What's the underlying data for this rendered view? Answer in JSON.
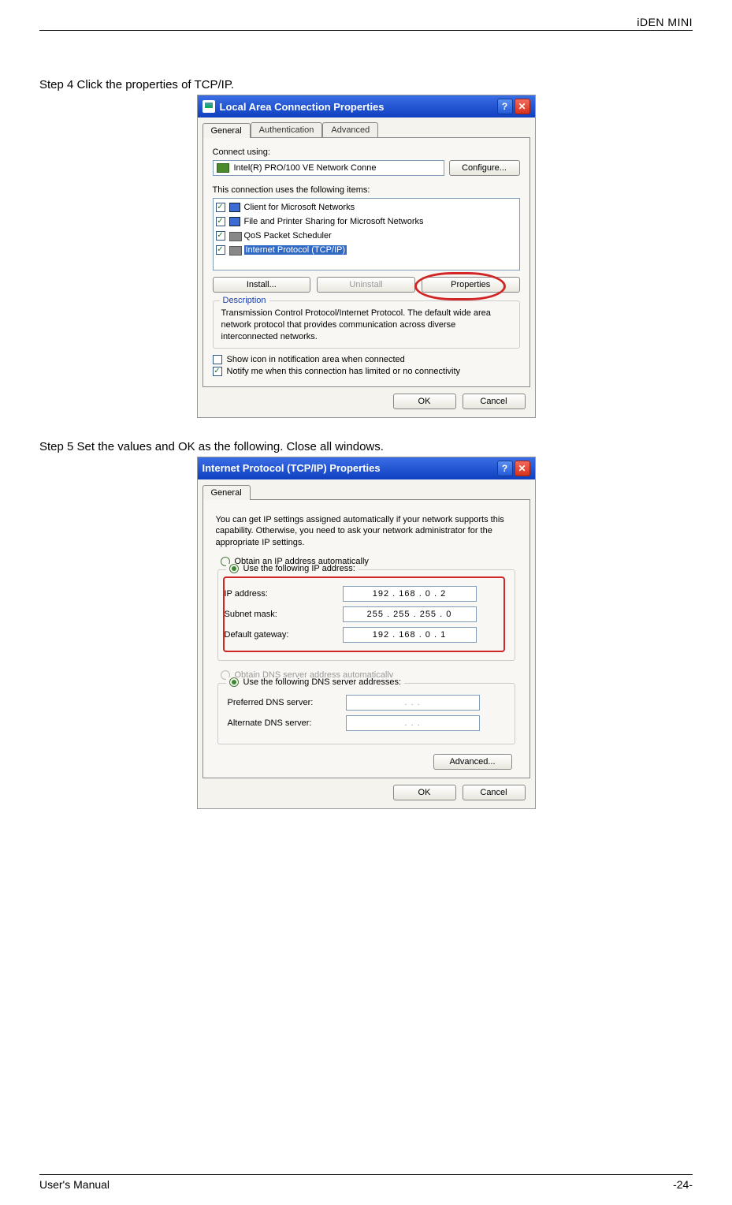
{
  "header": {
    "title": "iDEN MINI"
  },
  "step4": {
    "text": "Step 4 Click the properties of TCP/IP.",
    "dialog": {
      "title": "Local Area Connection Properties",
      "tabs": [
        "General",
        "Authentication",
        "Advanced"
      ],
      "connect_using_label": "Connect using:",
      "adapter": "Intel(R) PRO/100 VE Network Conne",
      "configure_btn": "Configure...",
      "items_label": "This connection uses the following items:",
      "items": [
        {
          "name": "Client for Microsoft Networks",
          "checked": true,
          "selected": false
        },
        {
          "name": "File and Printer Sharing for Microsoft Networks",
          "checked": true,
          "selected": false
        },
        {
          "name": "QoS Packet Scheduler",
          "checked": true,
          "selected": false
        },
        {
          "name": "Internet Protocol (TCP/IP)",
          "checked": true,
          "selected": true
        }
      ],
      "install_btn": "Install...",
      "uninstall_btn": "Uninstall",
      "properties_btn": "Properties",
      "description_label": "Description",
      "description_text": "Transmission Control Protocol/Internet Protocol. The default wide area network protocol that provides communication across diverse interconnected networks.",
      "show_icon_label": "Show icon in notification area when connected",
      "notify_label": "Notify me when this connection has limited or no connectivity",
      "ok_btn": "OK",
      "cancel_btn": "Cancel"
    }
  },
  "step5": {
    "text": "Step 5 Set the values and OK as the following. Close all windows.",
    "dialog": {
      "title": "Internet Protocol (TCP/IP) Properties",
      "tab": "General",
      "intro": "You can get IP settings assigned automatically if your network supports this capability. Otherwise, you need to ask your network administrator for the appropriate IP settings.",
      "obtain_ip_label": "Obtain an IP address automatically",
      "use_ip_label": "Use the following IP address:",
      "ip_label": "IP address:",
      "ip_value": "192 . 168 .  0  .  2",
      "subnet_label": "Subnet mask:",
      "subnet_value": "255 . 255 . 255 .  0",
      "gateway_label": "Default gateway:",
      "gateway_value": "192 . 168 .  0  .  1",
      "obtain_dns_label": "Obtain DNS server address automatically",
      "use_dns_label": "Use the following DNS server addresses:",
      "pref_dns_label": "Preferred DNS server:",
      "pref_dns_value": ".       .       .",
      "alt_dns_label": "Alternate DNS server:",
      "alt_dns_value": ".       .       .",
      "advanced_btn": "Advanced...",
      "ok_btn": "OK",
      "cancel_btn": "Cancel"
    }
  },
  "footer": {
    "left": "User's Manual",
    "right": "-24-"
  }
}
